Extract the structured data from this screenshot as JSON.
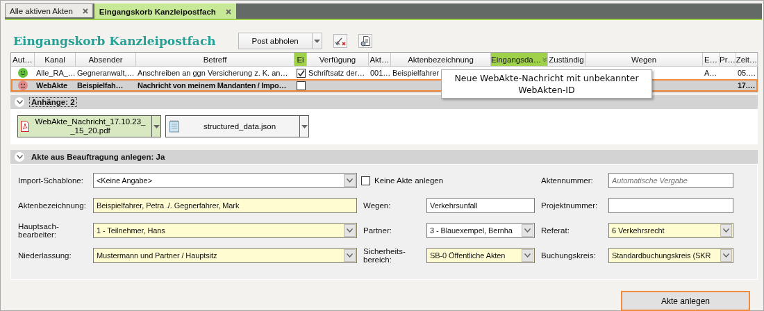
{
  "tabs": [
    {
      "label": "Alle aktiven Akten",
      "selected": false
    },
    {
      "label": "Eingangskorb Kanzleipostfach",
      "selected": true
    }
  ],
  "header": {
    "title": "Eingangskorb Kanzleipostfach",
    "fetch_button": "Post abholen"
  },
  "table": {
    "columns": [
      {
        "label": "Aut…",
        "kind": "status",
        "highlighted": false,
        "sorted": false
      },
      {
        "label": "Kanal",
        "kind": "text",
        "highlighted": false,
        "sorted": false
      },
      {
        "label": "Absender",
        "kind": "text",
        "highlighted": false,
        "sorted": false
      },
      {
        "label": "Betreff",
        "kind": "text",
        "highlighted": false,
        "sorted": false
      },
      {
        "label": "Ei",
        "kind": "check",
        "highlighted": true,
        "sorted": false
      },
      {
        "label": "Verfügung",
        "kind": "text",
        "highlighted": false,
        "sorted": false
      },
      {
        "label": "Akt…",
        "kind": "text",
        "highlighted": false,
        "sorted": false
      },
      {
        "label": "Aktenbezeichnung",
        "kind": "text",
        "highlighted": false,
        "sorted": false
      },
      {
        "label": "Eingangsda…",
        "kind": "text",
        "highlighted": true,
        "sorted": true
      },
      {
        "label": "Zuständig",
        "kind": "text",
        "highlighted": false,
        "sorted": false
      },
      {
        "label": "Wegen",
        "kind": "text",
        "highlighted": false,
        "sorted": false
      },
      {
        "label": "E…",
        "kind": "text",
        "highlighted": false,
        "sorted": false
      },
      {
        "label": "Pr…",
        "kind": "text",
        "highlighted": false,
        "sorted": false
      },
      {
        "label": "Zeit…",
        "kind": "text",
        "highlighted": false,
        "sorted": false
      }
    ],
    "rows": [
      {
        "selected": false,
        "color": "#62c23a",
        "checked": true,
        "cells": [
          "",
          "Alle_RA_…",
          "Gegneranwalt,…",
          "Anschreiben an ggn Versicherung z. K. an…",
          "",
          "Schriftsatz der…",
          "001…",
          "Beispielfahrer",
          "",
          "",
          "",
          "A…",
          "",
          "05.…"
        ]
      },
      {
        "selected": true,
        "color": "#e28a8a",
        "checked": false,
        "cells": [
          "",
          "WebAkte",
          "Beispielfah…",
          "Nachricht von meinem Mandanten / Impo…",
          "",
          "",
          "",
          "",
          "",
          "",
          "",
          "",
          "",
          "17.…"
        ]
      }
    ],
    "tooltip": "Neue WebAkte-Nachricht mit unbekannter WebAkten-ID"
  },
  "attachments": {
    "title": "Anhänge: 2",
    "expanded": true,
    "items": [
      {
        "name": "WebAkte_Nachricht_17.10.23__15_20.pdf",
        "kind": "pdf",
        "selected": true
      },
      {
        "name": "structured_data.json",
        "kind": "text",
        "selected": false
      }
    ]
  },
  "create_section": {
    "title": "Akte aus Beauftragung anlegen: Ja",
    "expanded": true,
    "fields": [
      {
        "label": "Import-Schablone:",
        "kind": "select",
        "value": "<Keine Angabe>",
        "required": false
      },
      {
        "label": "Keine Akte anlegen",
        "kind": "checkbox",
        "checked": false
      },
      {
        "label": "Aktennummer:",
        "kind": "text",
        "placeholder": "Automatische Vergabe",
        "required": false
      },
      {
        "label": "Aktenbezeichnung:",
        "kind": "text",
        "value": "Beispielfahrer, Petra ./. Gegnerfahrer, Mark",
        "required": true
      },
      {
        "label": "Wegen:",
        "kind": "text",
        "value": "Verkehrsunfall",
        "required": false
      },
      {
        "label": "Projektnummer:",
        "kind": "text",
        "required": false
      },
      {
        "label": "Hauptsach-bearbeiter:",
        "kind": "select",
        "value": "1 - Teilnehmer, Hans",
        "required": true
      },
      {
        "label": "Partner:",
        "kind": "select",
        "value": "3 - Blauexempel, Bernha",
        "required": false
      },
      {
        "label": "Referat:",
        "kind": "select",
        "value": "6 Verkehrsrecht",
        "required": true
      },
      {
        "label": "Niederlassung:",
        "kind": "select",
        "value": "Mustermann und Partner / Hauptsitz",
        "required": true
      },
      {
        "label": "Sicherheits-bereich:",
        "kind": "select",
        "value": "SB-0 Öffentliche Akten",
        "required": true
      },
      {
        "label": "Buchungskreis:",
        "kind": "select",
        "value": "Standardbuchungskreis (SKR",
        "required": true
      }
    ]
  },
  "submit_button": "Akte anlegen"
}
